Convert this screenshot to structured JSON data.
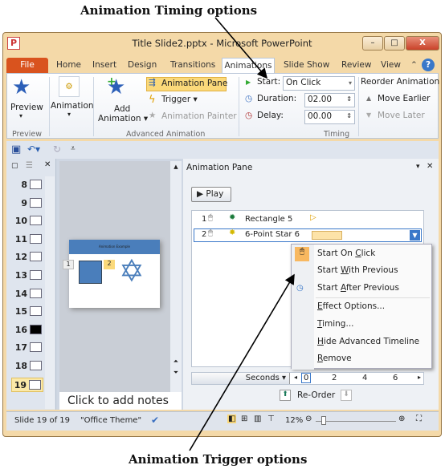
{
  "captions": {
    "top": "Animation Timing options",
    "bottom": "Animation Trigger options"
  },
  "window": {
    "title": "Title Slide2.pptx - Microsoft PowerPoint",
    "app_icon": "P",
    "minimize": "–",
    "maximize": "□",
    "close": "X"
  },
  "tabs": [
    "File",
    "Home",
    "Insert",
    "Design",
    "Transitions",
    "Animations",
    "Slide Show",
    "Review",
    "View"
  ],
  "active_tab": "Animations",
  "ribbon": {
    "preview": {
      "label": "Preview",
      "group": "Preview"
    },
    "animation": {
      "label": "Animation"
    },
    "add_animation": {
      "line1": "Add",
      "line2": "Animation ▾"
    },
    "animation_pane": "Animation Pane",
    "trigger": "Trigger ▾",
    "animation_painter": "Animation Painter",
    "advanced_group": "Advanced Animation",
    "start_label": "Start:",
    "start_value": "On Click",
    "duration_label": "Duration:",
    "duration_value": "02.00",
    "delay_label": "Delay:",
    "delay_value": "00.00",
    "timing_group": "Timing",
    "reorder_title": "Reorder Animation",
    "move_earlier": "Move Earlier",
    "move_later": "Move Later"
  },
  "slides": [
    "8",
    "9",
    "10",
    "11",
    "12",
    "13",
    "14",
    "15",
    "16",
    "17",
    "18",
    "19"
  ],
  "current_slide": "19",
  "slide_preview": {
    "title": "Animation Example",
    "tag1": "1",
    "tag2": "2"
  },
  "notes_placeholder": "Click to add notes",
  "animation_pane": {
    "title": "Animation Pane",
    "play": "Play",
    "items": [
      {
        "num": "1",
        "name": "Rectangle 5"
      },
      {
        "num": "2",
        "name": "6-Point Star 6"
      }
    ],
    "menu": {
      "start_on_click": {
        "pre": "Start On ",
        "u": "C",
        "post": "lick"
      },
      "start_with_previous": {
        "pre": "Start ",
        "u": "W",
        "post": "ith Previous"
      },
      "start_after_previous": {
        "pre": "Start ",
        "u": "A",
        "post": "fter Previous"
      },
      "effect_options": {
        "pre": "",
        "u": "E",
        "post": "ffect Options..."
      },
      "timing": {
        "pre": "",
        "u": "T",
        "post": "iming..."
      },
      "hide_timeline": {
        "pre": "",
        "u": "H",
        "post": "ide Advanced Timeline"
      },
      "remove": {
        "pre": "",
        "u": "R",
        "post": "emove"
      }
    },
    "seconds": "Seconds ▾",
    "ticks": [
      "0",
      "2",
      "4",
      "6"
    ],
    "reorder": "Re-Order"
  },
  "status": {
    "slide": "Slide 19 of 19",
    "theme": "\"Office Theme\"",
    "zoom": "12%"
  },
  "colors": {
    "file_tab": "#d9531e",
    "highlight": "#fbd97a",
    "slide_blue": "#4a7ebb"
  }
}
